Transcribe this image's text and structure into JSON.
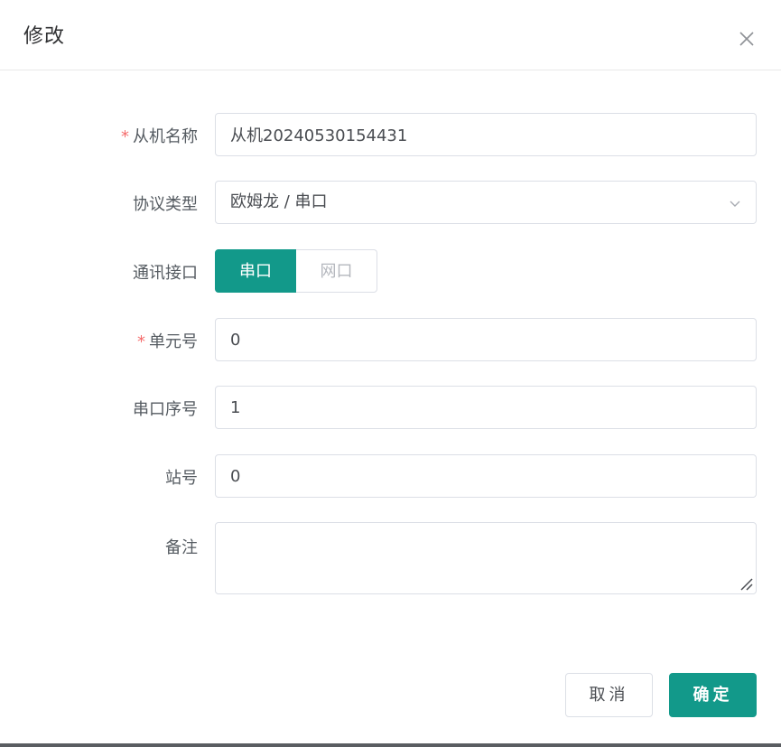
{
  "dialog": {
    "title": "修改",
    "close_icon": "close-icon"
  },
  "form": {
    "slave_name": {
      "required": true,
      "required_mark": "*",
      "label": "从机名称",
      "value": "从机20240530154431"
    },
    "protocol_type": {
      "label": "协议类型",
      "value": "欧姆龙 / 串口",
      "icon": "chevron-down-icon"
    },
    "comm_interface": {
      "label": "通讯接口",
      "options": [
        "串口",
        "网口"
      ],
      "selected": "串口"
    },
    "unit_no": {
      "required": true,
      "required_mark": "*",
      "label": "单元号",
      "value": "0"
    },
    "serial_port_no": {
      "label": "串口序号",
      "value": "1"
    },
    "station_no": {
      "label": "站号",
      "value": "0"
    },
    "remark": {
      "label": "备注",
      "value": ""
    }
  },
  "footer": {
    "cancel_label": "取消",
    "confirm_label": "确定"
  },
  "colors": {
    "accent": "#12998a",
    "required": "#f56c6c",
    "border": "#dcdfe6"
  }
}
